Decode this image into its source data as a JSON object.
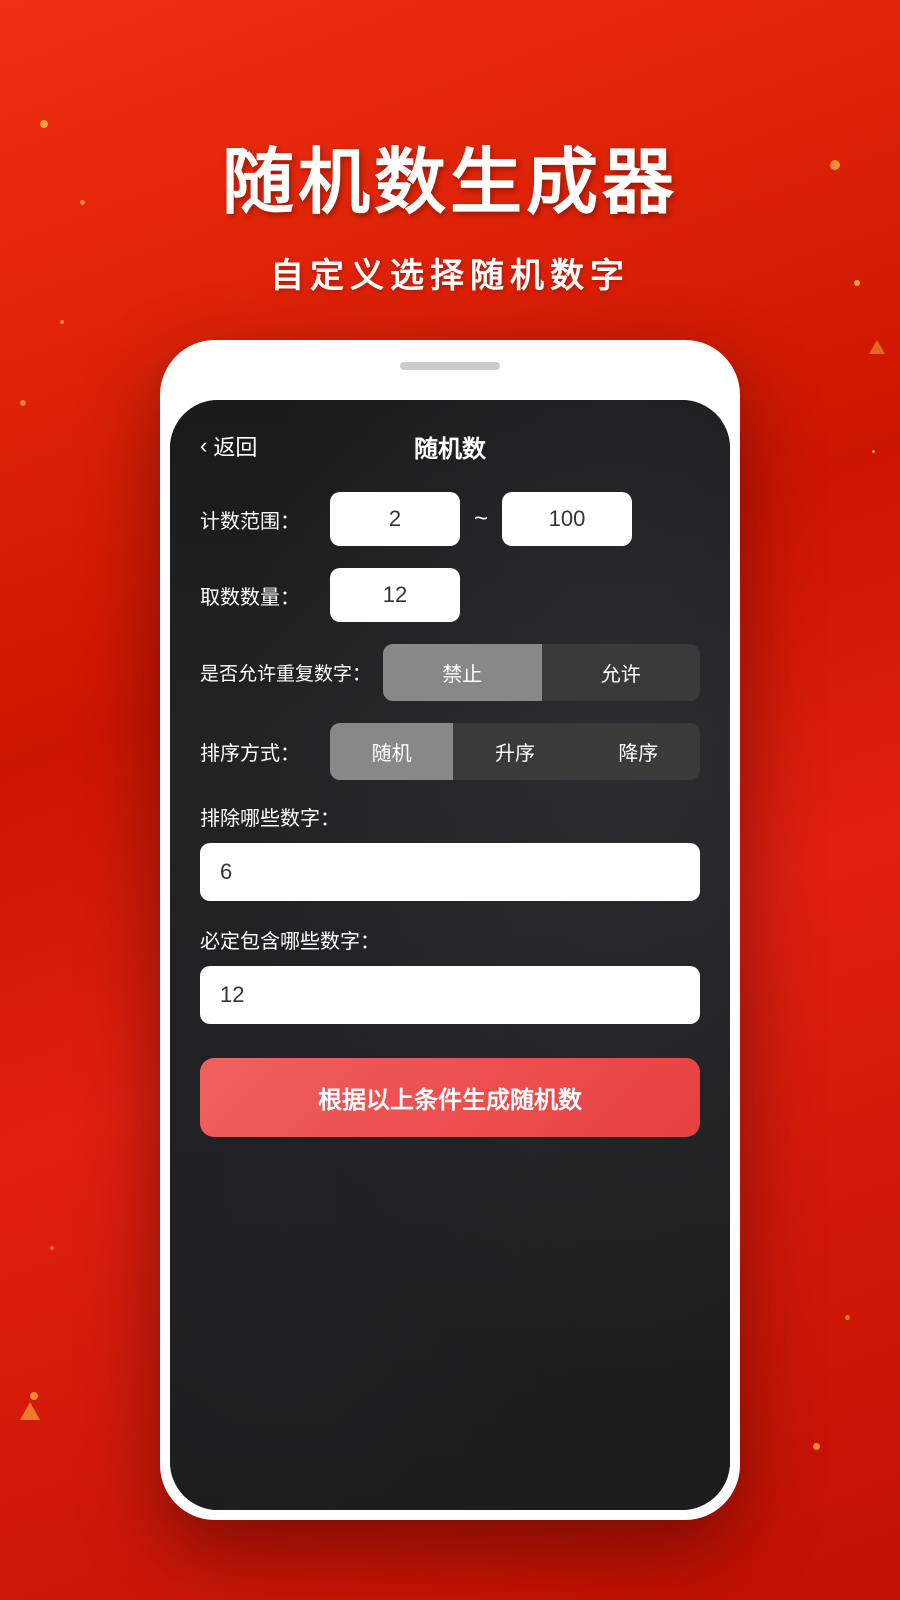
{
  "app": {
    "background_color": "#e8220a",
    "title": "随机数生成器",
    "subtitle": "自定义选择随机数字"
  },
  "nav": {
    "back_label": "返回",
    "page_title": "随机数"
  },
  "form": {
    "range_label": "计数范围：",
    "range_min": "2",
    "range_max": "100",
    "range_separator": "~",
    "count_label": "取数数量：",
    "count_value": "12",
    "duplicate_label": "是否允许重复数字：",
    "duplicate_options": [
      "禁止",
      "允许"
    ],
    "duplicate_active": 0,
    "sort_label": "排序方式：",
    "sort_options": [
      "随机",
      "升序",
      "降序"
    ],
    "sort_active": 0,
    "exclude_label": "排除哪些数字：",
    "exclude_value": "6",
    "include_label": "必定包含哪些数字：",
    "include_value": "12",
    "generate_button": "根据以上条件生成随机数"
  }
}
